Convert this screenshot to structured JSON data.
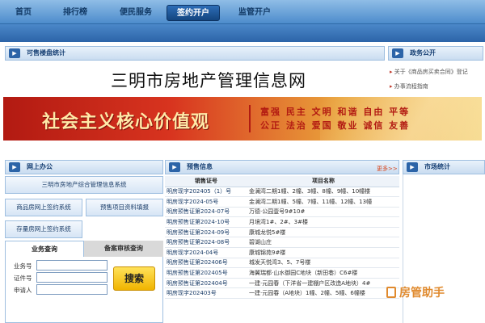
{
  "nav": {
    "items": [
      {
        "label": "首页",
        "active": false
      },
      {
        "label": "排行榜",
        "active": false
      },
      {
        "label": "便民服务",
        "active": false
      },
      {
        "label": "签约开户",
        "active": true
      },
      {
        "label": "监管开户",
        "active": false
      }
    ]
  },
  "headers": {
    "available_stats": "可售楼盘统计",
    "gov_public": "政务公开",
    "online_office": "网上办公",
    "presale_info": "预售信息",
    "market_stats": "市场统计"
  },
  "site_title": "三明市房地产管理信息网",
  "gov_links": [
    "关于《商品房买卖合同》登记",
    "办事流程指南"
  ],
  "banner": {
    "slogan": "社会主义核心价值观",
    "values_row1": "富强 民主 文明 和谐 自由 平等",
    "values_row2": "公正 法治 爱国 敬业 诚信 友善"
  },
  "left_panel": {
    "system_button": "三明市房地产综合管理信息系统",
    "sign_system": "商品房网上签约系统",
    "presale_fill": "预售项目资料填报",
    "stock_sign": "存量房网上签约系统",
    "tabs": [
      {
        "label": "业务查询",
        "active": true
      },
      {
        "label": "备案审核查询",
        "active": false
      }
    ],
    "form": {
      "business_no": "业务号",
      "cert_no": "证件号",
      "applicant": "申请人"
    },
    "search_button": "搜索"
  },
  "presale": {
    "more": "更多>>",
    "columns": [
      "销售证号",
      "项目名称"
    ],
    "rows": [
      [
        "明房现字202405（1）号",
        "金澜湾二期1幢、2幢、3幢、8幢、9幢、10幢楼"
      ],
      [
        "明房现字2024-05号",
        "金澜湾二期1幢、5幢、7幢、11幢、12幢、13幢"
      ],
      [
        "明房预售证第2024-07号",
        "万德·公园壹号9#10#"
      ],
      [
        "明房预售证第2024-10号",
        "月境湾1#、2#、3#楼"
      ],
      [
        "明房预售证第2024-09号",
        "康城龙悦5#楼"
      ],
      [
        "明房预售证第2024-08号",
        "碧湖山庄"
      ],
      [
        "明房现字2024-04号",
        "康城锦苑9#楼"
      ],
      [
        "明房预售证第202406号",
        "城发天悦湾3、5、7号楼"
      ],
      [
        "明房预售证第202405号",
        "海翼瑞都·山水御园C地块（新田巷）C6#楼"
      ],
      [
        "明房预售证第202404号",
        "一建·元园春（下洋省一建棚户区改造A地块）4#"
      ],
      [
        "明房现字202403号",
        "一建·元园春（A地块）1幢、2幢、5幢、6幢楼"
      ]
    ]
  },
  "watermark": "房管助手",
  "colors": {
    "nav_active": "#1a4f8f",
    "banner_red": "#c8231a",
    "banner_gold": "#ffe9a8",
    "search_button": "#f5c400",
    "more_link": "#d9461c"
  }
}
